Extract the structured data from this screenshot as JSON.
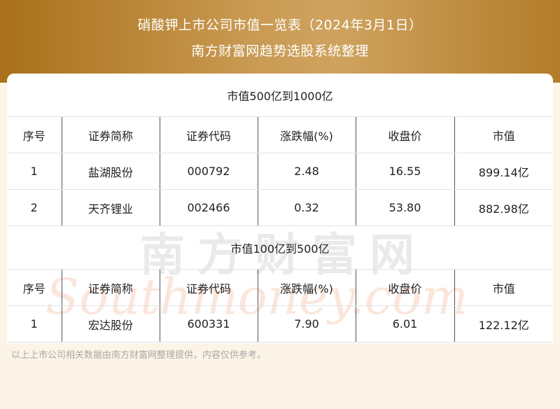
{
  "header": {
    "title_line1": "硝酸钾上市公司市值一览表（2024年3月1日）",
    "title_line2": "南方财富网趋势选股系统整理"
  },
  "watermark": {
    "chinese": "南方财富网",
    "english": "Southmoney.com"
  },
  "columns": [
    "序号",
    "证券简称",
    "证券代码",
    "涨跌幅(%)",
    "收盘价",
    "市值"
  ],
  "sections": [
    {
      "title": "市值500亿到1000亿",
      "rows": [
        [
          "1",
          "盐湖股份",
          "000792",
          "2.48",
          "16.55",
          "899.14亿"
        ],
        [
          "2",
          "天齐锂业",
          "002466",
          "0.32",
          "53.80",
          "882.98亿"
        ]
      ]
    },
    {
      "title": "市值100亿到500亿",
      "rows": [
        [
          "1",
          "宏达股份",
          "600331",
          "7.90",
          "6.01",
          "122.12亿"
        ]
      ]
    }
  ],
  "footer": "以上上市公司相关数据由南方财富网整理提供，内容仅供参考。"
}
